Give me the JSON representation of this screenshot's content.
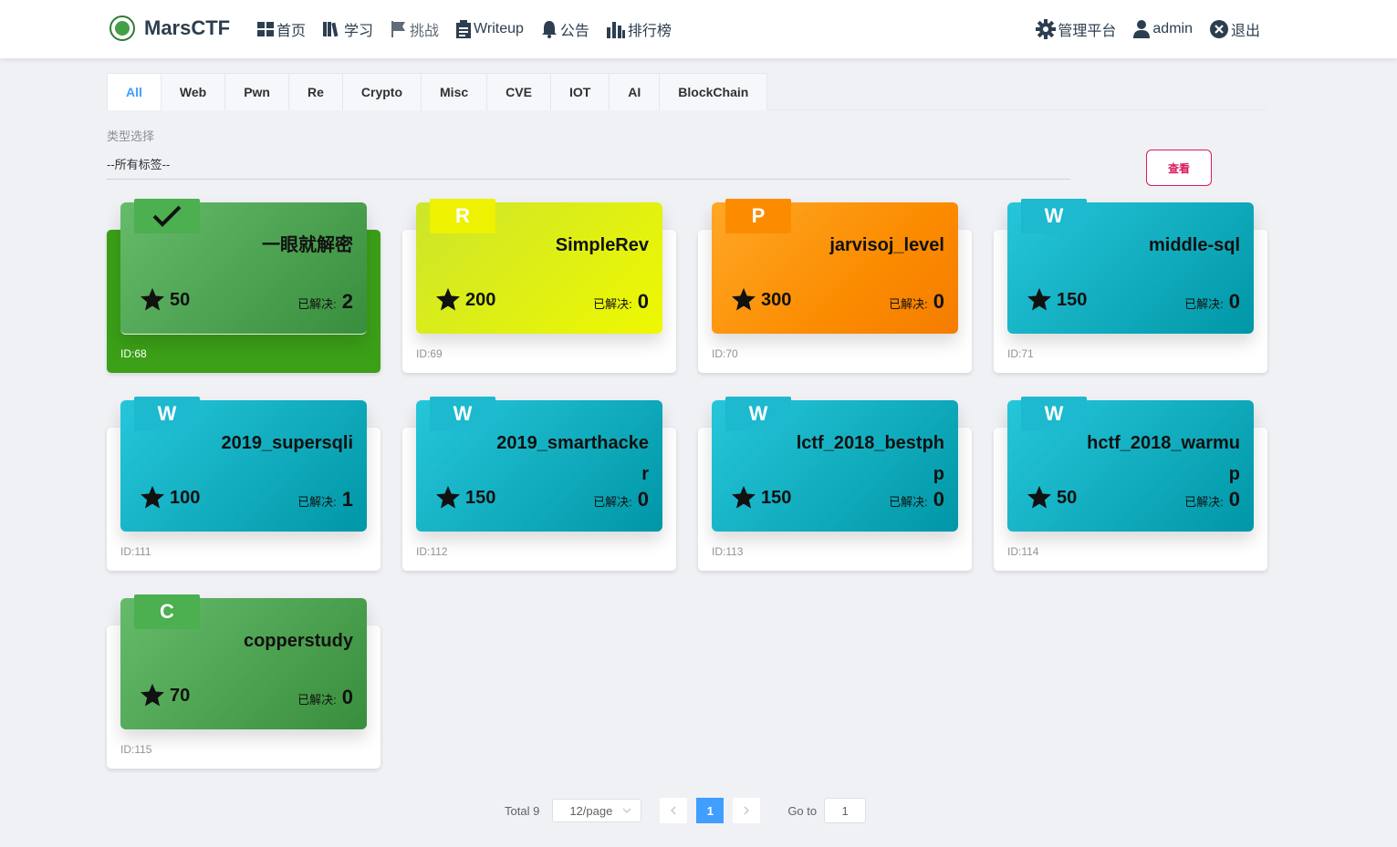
{
  "brand": {
    "name": "MarsCTF"
  },
  "nav": {
    "items": [
      {
        "label": "首页",
        "icon": "dashboard-icon"
      },
      {
        "label": "学习",
        "icon": "books-icon"
      },
      {
        "label": "挑战",
        "icon": "flag-icon"
      },
      {
        "label": "Writeup",
        "icon": "clipboard-icon"
      },
      {
        "label": "公告",
        "icon": "bell-icon"
      },
      {
        "label": "排行榜",
        "icon": "bar-chart-icon"
      }
    ],
    "right": [
      {
        "label": "管理平台",
        "icon": "gear-icon"
      },
      {
        "label": "admin",
        "icon": "user-icon"
      },
      {
        "label": "退出",
        "icon": "close-circle-icon"
      }
    ]
  },
  "tabs": [
    "All",
    "Web",
    "Pwn",
    "Re",
    "Crypto",
    "Misc",
    "CVE",
    "IOT",
    "AI",
    "BlockChain"
  ],
  "active_tab": "All",
  "filter": {
    "label": "类型选择",
    "value": "--所有标签--",
    "button": "查看"
  },
  "solved_label": "已解决:",
  "cards": [
    {
      "badge": "",
      "title": "一眼就解密",
      "score": "50",
      "solves": "2",
      "id": "ID:68",
      "theme": "green",
      "solved": true
    },
    {
      "badge": "R",
      "title": "SimpleRev",
      "score": "200",
      "solves": "0",
      "id": "ID:69",
      "theme": "yellow",
      "solved": false
    },
    {
      "badge": "P",
      "title": "jarvisoj_level",
      "score": "300",
      "solves": "0",
      "id": "ID:70",
      "theme": "orange",
      "solved": false
    },
    {
      "badge": "W",
      "title": "middle-sql",
      "score": "150",
      "solves": "0",
      "id": "ID:71",
      "theme": "cyan",
      "solved": false
    },
    {
      "badge": "W",
      "title": "2019_supersqli",
      "score": "100",
      "solves": "1",
      "id": "ID:111",
      "theme": "cyan",
      "solved": false
    },
    {
      "badge": "W",
      "title": "2019_smarthacker",
      "score": "150",
      "solves": "0",
      "id": "ID:112",
      "theme": "cyan",
      "solved": false
    },
    {
      "badge": "W",
      "title": "lctf_2018_bestphp",
      "score": "150",
      "solves": "0",
      "id": "ID:113",
      "theme": "cyan",
      "solved": false
    },
    {
      "badge": "W",
      "title": "hctf_2018_warmup",
      "score": "50",
      "solves": "0",
      "id": "ID:114",
      "theme": "cyan",
      "solved": false
    },
    {
      "badge": "C",
      "title": "copperstudy",
      "score": "70",
      "solves": "0",
      "id": "ID:115",
      "theme": "green",
      "solved": false
    }
  ],
  "pagination": {
    "total": "Total 9",
    "page_size": "12/page",
    "current": "1",
    "goto_label": "Go to",
    "goto_value": "1"
  },
  "colors": {
    "accent": "#409eff",
    "solved_bg": "#3ba017",
    "view_button": "#d81b60"
  }
}
